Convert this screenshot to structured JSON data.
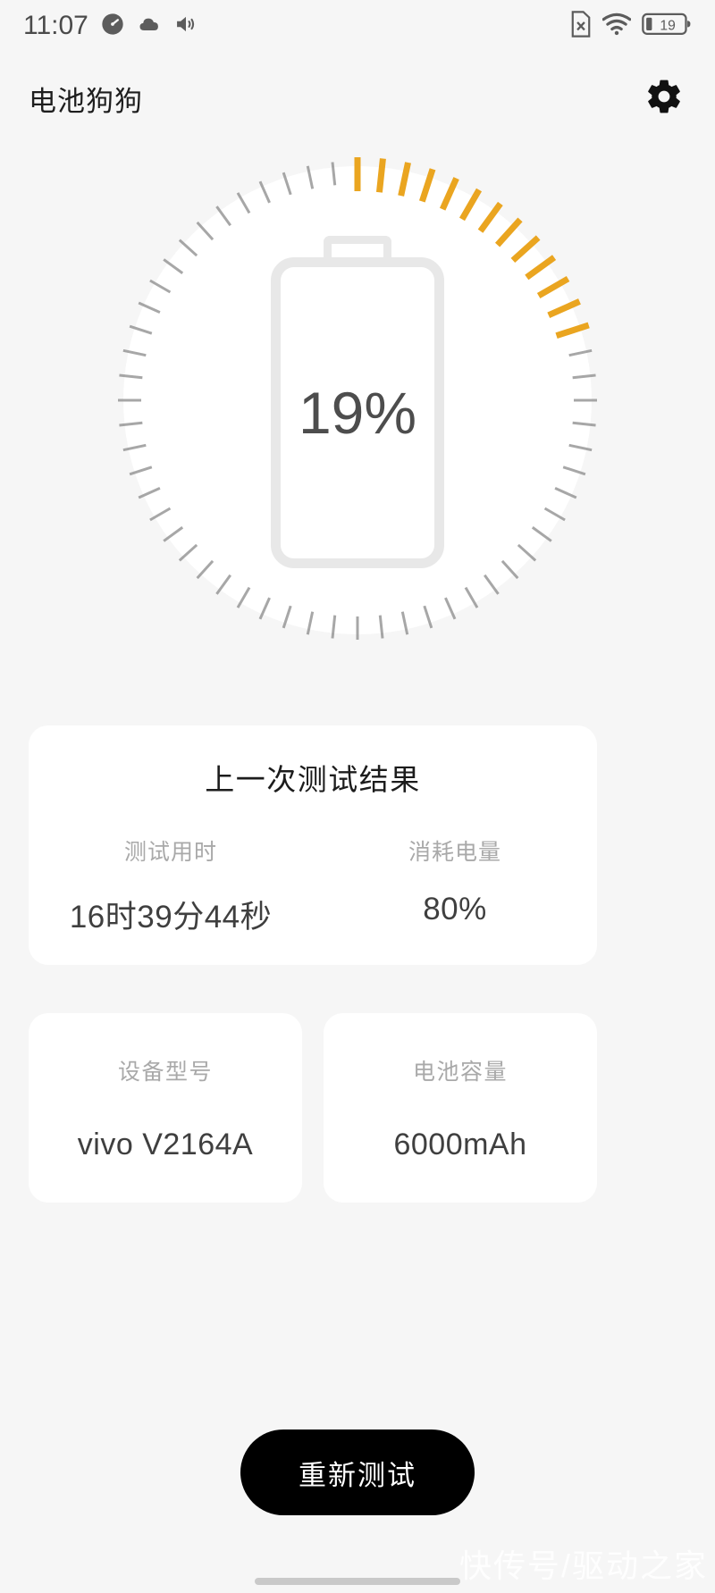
{
  "status_bar": {
    "time": "11:07",
    "left_icons": [
      "speedometer-icon",
      "cloud-icon",
      "volume-icon"
    ],
    "right_icons": [
      "sim-disabled-icon",
      "wifi-icon"
    ],
    "battery_level": "19"
  },
  "header": {
    "title": "电池狗狗",
    "settings_icon": "gear-icon"
  },
  "gauge": {
    "percent_label": "19%",
    "percent_value": 19,
    "total_ticks": 60,
    "active_ticks": 13,
    "active_color": "#eaa520",
    "inactive_color": "#8a8a8a",
    "battery_outline_color": "#e8e8e8",
    "disc_color": "#ffffff"
  },
  "result_card": {
    "title": "上一次测试结果",
    "columns": [
      {
        "label": "测试用时",
        "value": "16时39分44秒"
      },
      {
        "label": "消耗电量",
        "value": "80%"
      }
    ]
  },
  "info_cards": [
    {
      "label": "设备型号",
      "value": "vivo  V2164A"
    },
    {
      "label": "电池容量",
      "value": "6000mAh"
    }
  ],
  "actions": {
    "retest_label": "重新测试"
  },
  "watermark": {
    "text": "快传号/驱动之家"
  }
}
